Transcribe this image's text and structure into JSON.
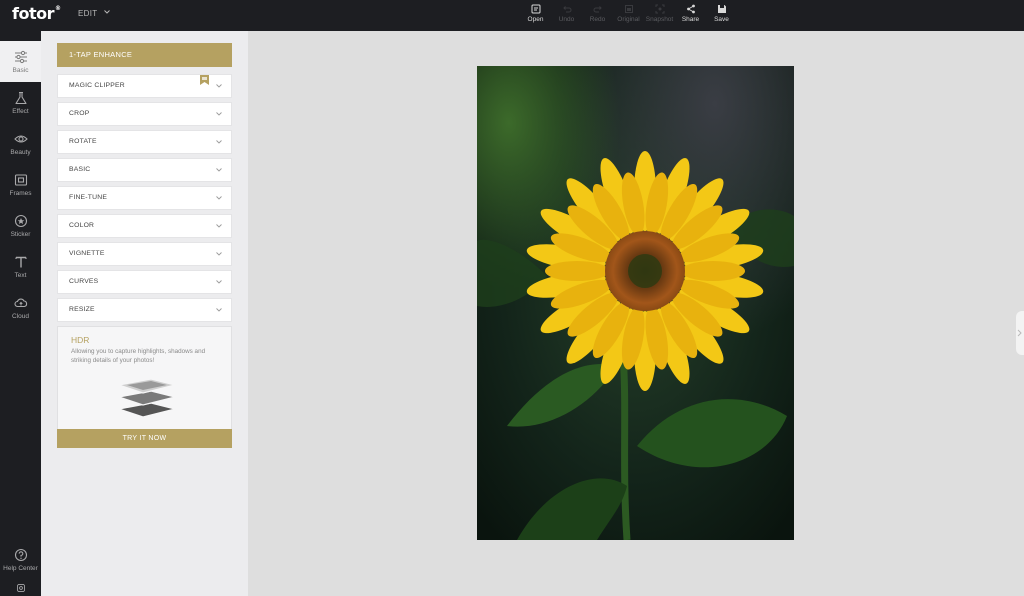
{
  "app": {
    "logo": "fotor",
    "logo_mark": "®",
    "menu_label": "EDIT"
  },
  "toolbar": [
    {
      "label": "Open",
      "icon": "open-icon",
      "enabled": true
    },
    {
      "label": "Undo",
      "icon": "undo-icon",
      "enabled": false
    },
    {
      "label": "Redo",
      "icon": "redo-icon",
      "enabled": false
    },
    {
      "label": "Original",
      "icon": "original-icon",
      "enabled": false
    },
    {
      "label": "Snapshot",
      "icon": "snapshot-icon",
      "enabled": false
    },
    {
      "label": "Share",
      "icon": "share-icon",
      "enabled": true
    },
    {
      "label": "Save",
      "icon": "save-icon",
      "enabled": true
    }
  ],
  "leftnav": [
    {
      "label": "Basic",
      "icon": "sliders-icon",
      "active": true
    },
    {
      "label": "Effect",
      "icon": "flask-icon",
      "active": false
    },
    {
      "label": "Beauty",
      "icon": "eye-icon",
      "active": false
    },
    {
      "label": "Frames",
      "icon": "frame-icon",
      "active": false
    },
    {
      "label": "Sticker",
      "icon": "sticker-icon",
      "active": false
    },
    {
      "label": "Text",
      "icon": "text-icon",
      "active": false
    },
    {
      "label": "Cloud",
      "icon": "cloud-icon",
      "active": false
    },
    {
      "label": "Help Center",
      "icon": "help-icon",
      "active": false
    }
  ],
  "panel": {
    "enhance_label": "1-TAP ENHANCE",
    "items": [
      {
        "label": "MAGIC CLIPPER",
        "badge": "bookmark-icon"
      },
      {
        "label": "CROP"
      },
      {
        "label": "ROTATE"
      },
      {
        "label": "BASIC"
      },
      {
        "label": "FINE-TUNE"
      },
      {
        "label": "COLOR"
      },
      {
        "label": "VIGNETTE"
      },
      {
        "label": "CURVES"
      },
      {
        "label": "RESIZE"
      }
    ],
    "hdr": {
      "title": "HDR",
      "description": "Allowing you to capture highlights, shadows and striking details of your photos!",
      "button": "TRY IT NOW"
    }
  },
  "colors": {
    "accent": "#b5a161",
    "dark_bg": "#1d1e22",
    "panel_bg": "#ececee",
    "canvas_bg": "#dedede"
  },
  "canvas": {
    "image_subject": "sunflower photo"
  }
}
